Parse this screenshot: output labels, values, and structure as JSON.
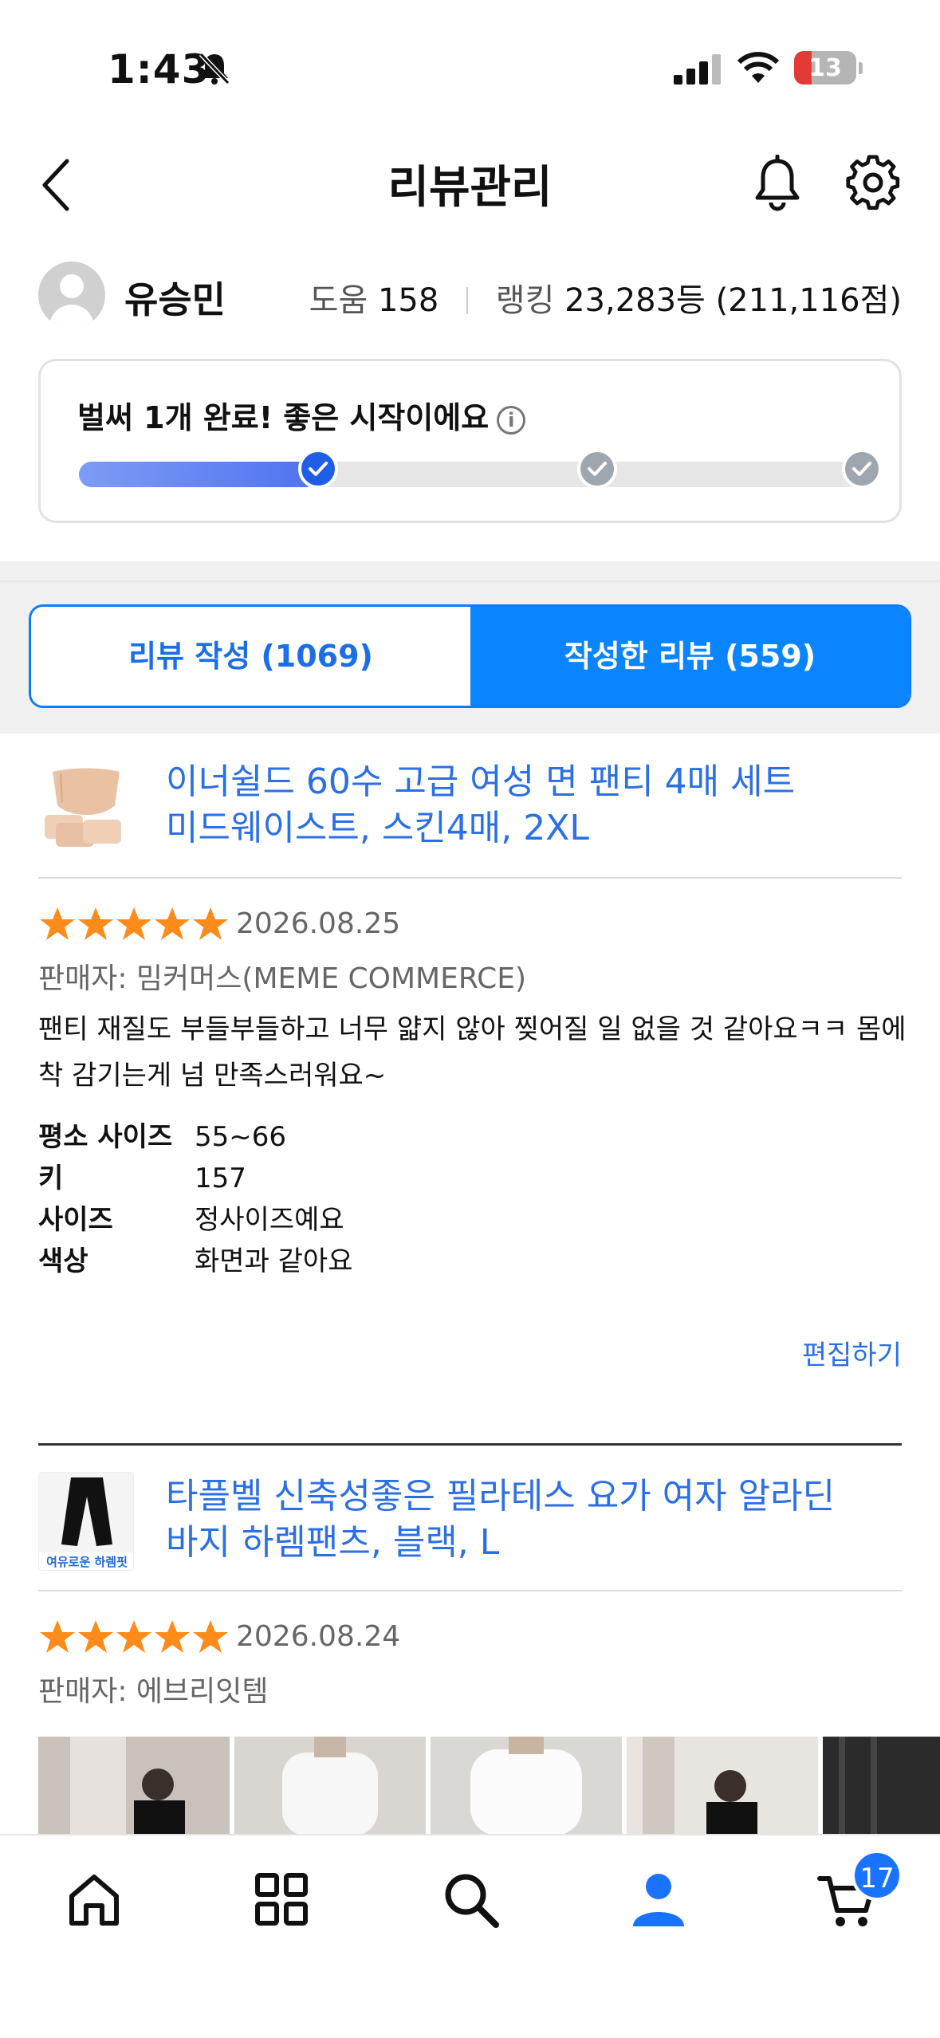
{
  "status_bar": {
    "time": "1:43",
    "battery": "13"
  },
  "header": {
    "title": "리뷰관리"
  },
  "profile": {
    "name": "유승민",
    "help_label": "도움",
    "help_count": "158",
    "rank_label": "랭킹",
    "rank_value": "23,283등 (211,116점)"
  },
  "progress": {
    "message": "벌써 1개 완료! 좋은 시작이에요",
    "completed_steps": 1,
    "total_steps": 3
  },
  "tabs": [
    {
      "label": "리뷰 작성 (1069)",
      "active": false
    },
    {
      "label": "작성한 리뷰 (559)",
      "active": true
    }
  ],
  "reviews": [
    {
      "product_line1": "이너쉴드 60수 고급 여성 면 팬티 4매 세트",
      "product_line2": "미드웨이스트, 스킨4매, 2XL",
      "rating": 5,
      "date": "2026.08.25",
      "seller": "판매자: 밈커머스(MEME COMMERCE)",
      "text_line1": "팬티 재질도 부들부들하고 너무 얇지 않아 찢어질 일 없을 것 같아요ㅋㅋ 몸에",
      "text_line2": "착 감기는게 넘 만족스러워요~",
      "specs": [
        {
          "key": "평소 사이즈",
          "value": "55~66"
        },
        {
          "key": "키",
          "value": "157"
        },
        {
          "key": "사이즈",
          "value": "정사이즈예요"
        },
        {
          "key": "색상",
          "value": "화면과 같아요"
        }
      ],
      "edit_label": "편집하기"
    },
    {
      "product_line1": "타플벨 신축성좋은 필라테스 요가 여자 알라딘",
      "product_line2": "바지 하렘팬츠, 블랙, L",
      "thumb_caption": "여유로운 하렘핏",
      "rating": 5,
      "date": "2026.08.24",
      "seller": "판매자: 에브리잇템"
    }
  ],
  "bottom_nav": {
    "items": [
      "home-icon",
      "category-grid-icon",
      "search-icon",
      "profile-icon",
      "cart-icon"
    ],
    "cart_badge": "17"
  },
  "colors": {
    "accent": "#0a84ff",
    "link": "#2b6fe6",
    "star": "#ff8c1a"
  }
}
